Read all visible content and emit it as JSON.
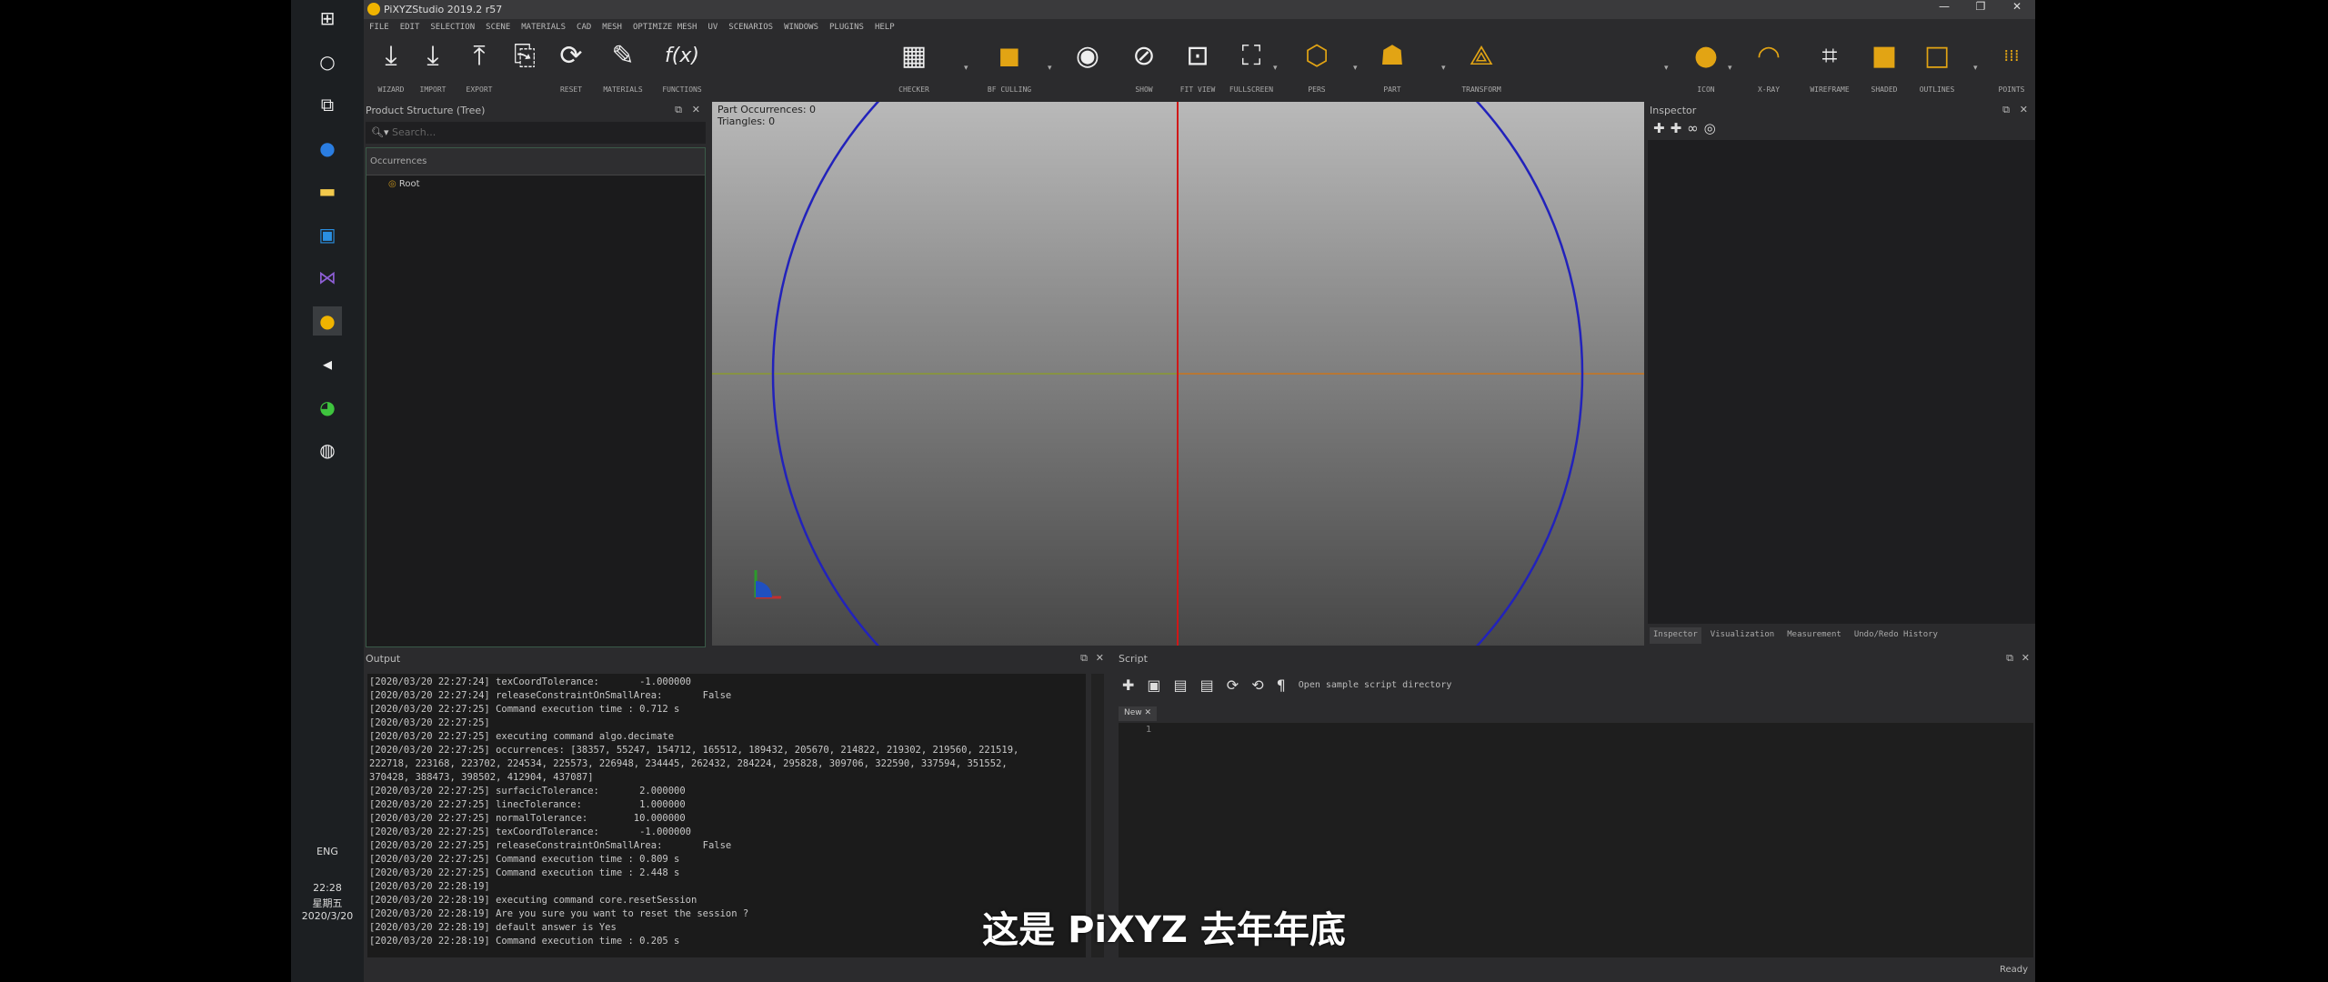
{
  "taskbar": {
    "icons": [
      "windows-icon",
      "cortana-icon",
      "task-view-icon",
      "maps-icon",
      "file-explorer-icon",
      "store-icon",
      "visual-studio-icon",
      "pixyz-icon",
      "terminal-icon",
      "wechat-icon",
      "settings-icon"
    ],
    "lang": "ENG",
    "time": "22:28",
    "weekday": "星期五",
    "date": "2020/3/20"
  },
  "window": {
    "title": "PiXYZStudio 2019.2 r57",
    "min": "—",
    "max": "❐",
    "close": "✕"
  },
  "menu": [
    "FILE",
    "EDIT",
    "SELECTION",
    "SCENE",
    "MATERIALS",
    "CAD",
    "MESH",
    "OPTIMIZE MESH",
    "UV",
    "SCENARIOS",
    "WINDOWS",
    "PLUGINS",
    "HELP"
  ],
  "toolbar": {
    "left": [
      {
        "icon": "wizard-import-icon",
        "glyph": "⤓",
        "label": "WIZARD"
      },
      {
        "icon": "import-icon",
        "glyph": "⤓",
        "label": "IMPORT"
      },
      {
        "icon": "export-icon",
        "glyph": "⤒",
        "label": "EXPORT"
      },
      {
        "icon": "file-import-icon",
        "glyph": "⎘",
        "label": ""
      },
      {
        "icon": "reset-icon",
        "glyph": "⟳",
        "label": "RESET"
      },
      {
        "icon": "materials-icon",
        "glyph": "✎",
        "label": "MATERIALS"
      },
      {
        "icon": "functions-icon",
        "glyph": "f(x)",
        "label": "FUNCTIONS"
      }
    ],
    "right": [
      {
        "icon": "checker-icon",
        "glyph": "▦",
        "label": "CHECKER",
        "gold": false
      },
      {
        "icon": "bf-culling-icon",
        "glyph": "◼",
        "label": "BF CULLING",
        "gold": true
      },
      {
        "icon": "eye-icon",
        "glyph": "◉",
        "label": "",
        "gold": false
      },
      {
        "icon": "show-icon",
        "glyph": "⊘",
        "label": "SHOW",
        "gold": false
      },
      {
        "icon": "fit-view-icon",
        "glyph": "⊡",
        "label": "FIT VIEW",
        "gold": false
      },
      {
        "icon": "fullscreen-icon",
        "glyph": "⛶",
        "label": "FULLSCREEN",
        "gold": false
      },
      {
        "icon": "perspective-icon",
        "glyph": "⬡",
        "label": "PERS",
        "gold": true
      },
      {
        "icon": "part-icon",
        "glyph": "☗",
        "label": "PART",
        "gold": true
      },
      {
        "icon": "transform-icon",
        "glyph": "⟁",
        "label": "TRANSFORM",
        "gold": true
      },
      {
        "icon": "icon-mode-icon",
        "glyph": "●",
        "label": "ICON",
        "gold": true
      },
      {
        "icon": "x-ray-icon",
        "glyph": "◠",
        "label": "X-RAY",
        "gold": true
      },
      {
        "icon": "wireframe-icon",
        "glyph": "⌗",
        "label": "WIREFRAME",
        "gold": false
      },
      {
        "icon": "shaded-icon",
        "glyph": "■",
        "label": "SHADED",
        "gold": true
      },
      {
        "icon": "outlines-icon",
        "glyph": "□",
        "label": "OUTLINES",
        "gold": true
      },
      {
        "icon": "points-icon",
        "glyph": "⁞⁞⁞",
        "label": "POINTS",
        "gold": true
      }
    ]
  },
  "tree": {
    "title": "Product Structure (Tree)",
    "search_placeholder": "Search...",
    "column": "Occurrences",
    "root": "Root"
  },
  "viewport": {
    "info1": "Part Occurrences: 0",
    "info2": "Triangles: 0"
  },
  "inspector": {
    "title": "Inspector",
    "tabs": [
      "Inspector",
      "Visualization",
      "Measurement",
      "Undo/Redo History"
    ]
  },
  "output": {
    "title": "Output",
    "lines": [
      "[2020/03/20 22:27:24] texCoordTolerance:       -1.000000",
      "[2020/03/20 22:27:24] releaseConstraintOnSmallArea:       False",
      "[2020/03/20 22:27:25] Command execution time : 0.712 s",
      "[2020/03/20 22:27:25]",
      "[2020/03/20 22:27:25] executing command algo.decimate",
      "[2020/03/20 22:27:25] occurrences: [38357, 55247, 154712, 165512, 189432, 205670, 214822, 219302, 219560, 221519,",
      "222718, 223168, 223702, 224534, 225573, 226948, 234445, 262432, 284224, 295828, 309706, 322590, 337594, 351552,",
      "370428, 388473, 398502, 412904, 437087]",
      "[2020/03/20 22:27:25] surfacicTolerance:       2.000000",
      "[2020/03/20 22:27:25] linecTolerance:          1.000000",
      "[2020/03/20 22:27:25] normalTolerance:        10.000000",
      "[2020/03/20 22:27:25] texCoordTolerance:       -1.000000",
      "[2020/03/20 22:27:25] releaseConstraintOnSmallArea:       False",
      "[2020/03/20 22:27:25] Command execution time : 0.809 s",
      "[2020/03/20 22:27:25] Command execution time : 2.448 s",
      "[2020/03/20 22:28:19]",
      "[2020/03/20 22:28:19] executing command core.resetSession",
      "[2020/03/20 22:28:19] Are you sure you want to reset the session ?",
      "[2020/03/20 22:28:19] default answer is Yes",
      "[2020/03/20 22:28:19] Command execution time : 0.205 s"
    ]
  },
  "script": {
    "title": "Script",
    "open_sample": "Open sample script directory",
    "tab": "New",
    "line_number": "1"
  },
  "status": "Ready",
  "subtitle": "这是 PiXYZ 去年年底"
}
